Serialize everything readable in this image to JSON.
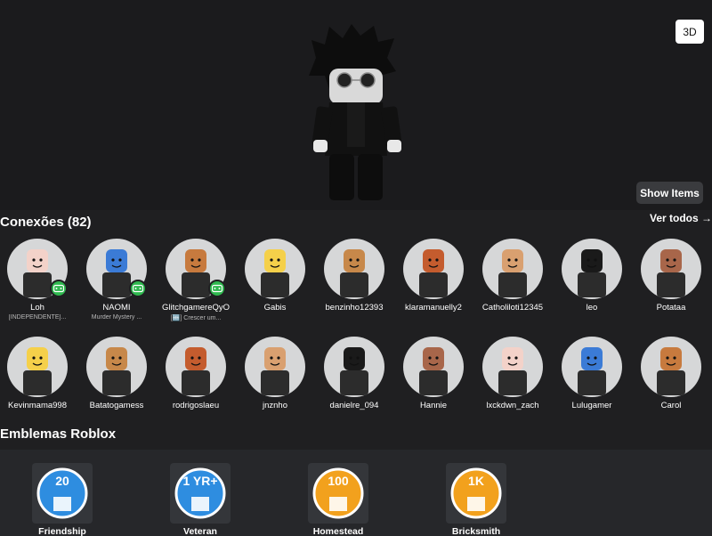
{
  "viewer": {
    "toggle_3d_label": "3D",
    "show_items_label": "Show Items"
  },
  "connections": {
    "title": "Conexões (82)",
    "see_all": "Ver todos →",
    "row1": [
      {
        "name": "Loh",
        "sub": "[INDEPENDENTE]...",
        "online": true
      },
      {
        "name": "NAOMI",
        "sub": "Murder Mystery ...",
        "online": true
      },
      {
        "name": "GlitchgamereQyO",
        "sub": "[🆕] Crescer um...",
        "online": true
      },
      {
        "name": "Gabis",
        "sub": "",
        "online": false
      },
      {
        "name": "benzinho12393",
        "sub": "",
        "online": false
      },
      {
        "name": "klaramanuelly2",
        "sub": "",
        "online": false
      },
      {
        "name": "Catholiloti12345",
        "sub": "",
        "online": false
      },
      {
        "name": "leo",
        "sub": "",
        "online": false
      },
      {
        "name": "Potataa",
        "sub": "",
        "online": false
      }
    ],
    "row2": [
      {
        "name": "Kevinmama998"
      },
      {
        "name": "Batatogamess"
      },
      {
        "name": "rodrigoslaeu"
      },
      {
        "name": "jnznho"
      },
      {
        "name": "danielre_094"
      },
      {
        "name": "Hannie"
      },
      {
        "name": "lxckdwn_zach"
      },
      {
        "name": "Lulugamer"
      },
      {
        "name": "Carol"
      }
    ]
  },
  "badges": {
    "title": "Emblemas Roblox",
    "items": [
      {
        "label": "Friendship",
        "emblem": "20",
        "color": "#2e8de0",
        "icon": "friends-icon"
      },
      {
        "label": "Veteran",
        "emblem": "1 YR+",
        "color": "#2e8de0",
        "icon": "shield-icon"
      },
      {
        "label": "Homestead",
        "emblem": "100",
        "color": "#f2a11d",
        "icon": "house-icon"
      },
      {
        "label": "Bricksmith",
        "emblem": "1K",
        "color": "#f2a11d",
        "icon": "castle-icon"
      }
    ]
  },
  "colors": {
    "background": "#1f1f21",
    "online": "#2fb84f",
    "panel": "#26272a"
  }
}
